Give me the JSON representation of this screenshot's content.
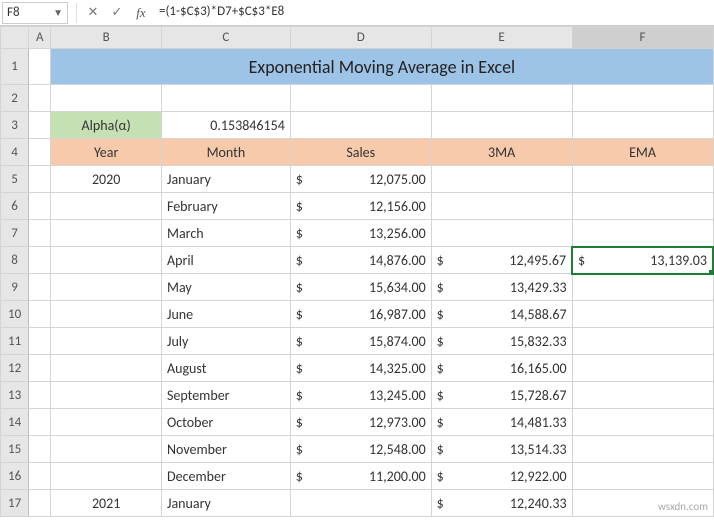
{
  "name_box": "F8",
  "formula": "=(1-$C$3)*D7+$C$3*E8",
  "columns": [
    "A",
    "B",
    "C",
    "D",
    "E",
    "F"
  ],
  "row_numbers": [
    1,
    2,
    3,
    4,
    5,
    6,
    7,
    8,
    9,
    10,
    11,
    12,
    13,
    14,
    15,
    16,
    17
  ],
  "title": "Exponential Moving Average in Excel",
  "alpha_label": "Alpha(α)",
  "alpha_value": "0.153846154",
  "headers": {
    "year": "Year",
    "month": "Month",
    "sales": "Sales",
    "ma3": "3MA",
    "ema": "EMA"
  },
  "rows": [
    {
      "year": "2020",
      "month": "January",
      "sales": "12,075.00",
      "ma3": "",
      "ema": ""
    },
    {
      "year": "",
      "month": "February",
      "sales": "12,156.00",
      "ma3": "",
      "ema": ""
    },
    {
      "year": "",
      "month": "March",
      "sales": "13,256.00",
      "ma3": "",
      "ema": ""
    },
    {
      "year": "",
      "month": "April",
      "sales": "14,876.00",
      "ma3": "12,495.67",
      "ema": "13,139.03"
    },
    {
      "year": "",
      "month": "May",
      "sales": "15,634.00",
      "ma3": "13,429.33",
      "ema": ""
    },
    {
      "year": "",
      "month": "June",
      "sales": "16,987.00",
      "ma3": "14,588.67",
      "ema": ""
    },
    {
      "year": "",
      "month": "July",
      "sales": "15,874.00",
      "ma3": "15,832.33",
      "ema": ""
    },
    {
      "year": "",
      "month": "August",
      "sales": "14,325.00",
      "ma3": "16,165.00",
      "ema": ""
    },
    {
      "year": "",
      "month": "September",
      "sales": "13,245.00",
      "ma3": "15,728.67",
      "ema": ""
    },
    {
      "year": "",
      "month": "October",
      "sales": "12,973.00",
      "ma3": "14,481.33",
      "ema": ""
    },
    {
      "year": "",
      "month": "November",
      "sales": "12,548.00",
      "ma3": "13,514.33",
      "ema": ""
    },
    {
      "year": "",
      "month": "December",
      "sales": "11,200.00",
      "ma3": "12,922.00",
      "ema": ""
    },
    {
      "year": "2021",
      "month": "January",
      "sales": "",
      "ma3": "12,240.33",
      "ema": ""
    }
  ],
  "currency_symbol": "$",
  "watermark": "wsxdn.com",
  "chart_data": {
    "type": "table",
    "title": "Exponential Moving Average in Excel",
    "alpha": 0.153846154,
    "columns": [
      "Year",
      "Month",
      "Sales",
      "3MA",
      "EMA"
    ],
    "records": [
      {
        "Year": 2020,
        "Month": "January",
        "Sales": 12075.0,
        "3MA": null,
        "EMA": null
      },
      {
        "Year": 2020,
        "Month": "February",
        "Sales": 12156.0,
        "3MA": null,
        "EMA": null
      },
      {
        "Year": 2020,
        "Month": "March",
        "Sales": 13256.0,
        "3MA": null,
        "EMA": null
      },
      {
        "Year": 2020,
        "Month": "April",
        "Sales": 14876.0,
        "3MA": 12495.67,
        "EMA": 13139.03
      },
      {
        "Year": 2020,
        "Month": "May",
        "Sales": 15634.0,
        "3MA": 13429.33,
        "EMA": null
      },
      {
        "Year": 2020,
        "Month": "June",
        "Sales": 16987.0,
        "3MA": 14588.67,
        "EMA": null
      },
      {
        "Year": 2020,
        "Month": "July",
        "Sales": 15874.0,
        "3MA": 15832.33,
        "EMA": null
      },
      {
        "Year": 2020,
        "Month": "August",
        "Sales": 14325.0,
        "3MA": 16165.0,
        "EMA": null
      },
      {
        "Year": 2020,
        "Month": "September",
        "Sales": 13245.0,
        "3MA": 15728.67,
        "EMA": null
      },
      {
        "Year": 2020,
        "Month": "October",
        "Sales": 12973.0,
        "3MA": 14481.33,
        "EMA": null
      },
      {
        "Year": 2020,
        "Month": "November",
        "Sales": 12548.0,
        "3MA": 13514.33,
        "EMA": null
      },
      {
        "Year": 2020,
        "Month": "December",
        "Sales": 11200.0,
        "3MA": 12922.0,
        "EMA": null
      },
      {
        "Year": 2021,
        "Month": "January",
        "Sales": null,
        "3MA": 12240.33,
        "EMA": null
      }
    ]
  }
}
